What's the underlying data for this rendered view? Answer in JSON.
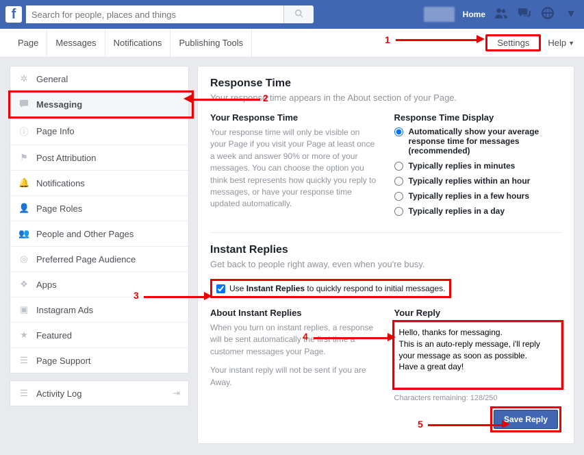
{
  "topbar": {
    "search_placeholder": "Search for people, places and things",
    "home": "Home"
  },
  "tabs": {
    "page": "Page",
    "messages": "Messages",
    "notifications": "Notifications",
    "publishing": "Publishing Tools",
    "settings": "Settings",
    "help": "Help"
  },
  "sidebar": {
    "general": "General",
    "messaging": "Messaging",
    "page_info": "Page Info",
    "post_attribution": "Post Attribution",
    "notifications": "Notifications",
    "page_roles": "Page Roles",
    "people": "People and Other Pages",
    "preferred": "Preferred Page Audience",
    "apps": "Apps",
    "instagram": "Instagram Ads",
    "featured": "Featured",
    "page_support": "Page Support",
    "activity_log": "Activity Log"
  },
  "response": {
    "title": "Response Time",
    "sub": "Your response time appears in the About section of your Page.",
    "your_title": "Your Response Time",
    "your_text": "Your response time will only be visible on your Page if you visit your Page at least once a week and answer 90% or more of your messages. You can choose the option you think best represents how quickly you reply to messages, or have your response time updated automatically.",
    "display_title": "Response Time Display",
    "opt_auto": "Automatically show your average response time for messages (recommended)",
    "opt_minutes": "Typically replies in minutes",
    "opt_hour": "Typically replies within an hour",
    "opt_fewhours": "Typically replies in a few hours",
    "opt_day": "Typically replies in a day"
  },
  "instant": {
    "title": "Instant Replies",
    "sub": "Get back to people right away, even when you're busy.",
    "checkbox_pre": "Use ",
    "checkbox_bold": "Instant Replies",
    "checkbox_post": " to quickly respond to initial messages.",
    "about_title": "About Instant Replies",
    "about_text": "When you turn on instant replies, a response will be sent automatically the first time a customer messages your Page.",
    "about_note": "Your instant reply will not be sent if you are Away.",
    "reply_title": "Your Reply",
    "reply_value": "Hello, thanks for messaging.\nThis is an auto-reply message, i'll reply your message as soon as possible.\nHave a great day!",
    "char_remain": "Characters remaining: 128/250",
    "save": "Save Reply"
  },
  "anno": {
    "n1": "1",
    "n2": "2",
    "n3": "3",
    "n4": "4",
    "n5": "5"
  }
}
